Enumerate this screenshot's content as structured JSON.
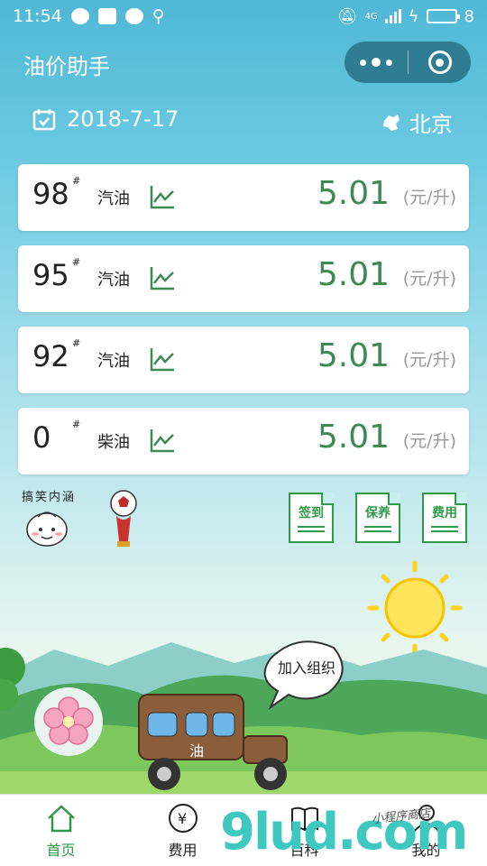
{
  "status_bar": {
    "time": "11:54",
    "network": "4G",
    "battery": "8"
  },
  "header": {
    "title": "油价助手"
  },
  "info": {
    "date": "2018-7-17",
    "city": "北京"
  },
  "prices": [
    {
      "grade": "98",
      "sharp": "#",
      "type": "汽油",
      "price": "5.01",
      "unit": "(元/升)"
    },
    {
      "grade": "95",
      "sharp": "#",
      "type": "汽油",
      "price": "5.01",
      "unit": "(元/升)"
    },
    {
      "grade": "92",
      "sharp": "#",
      "type": "汽油",
      "price": "5.01",
      "unit": "(元/升)"
    },
    {
      "grade": "0",
      "sharp": "#",
      "type": "柴油",
      "price": "5.01",
      "unit": "(元/升)"
    }
  ],
  "stickers": {
    "left_text": "搞笑内涵"
  },
  "doc_buttons": [
    {
      "label": "签到"
    },
    {
      "label": "保养"
    },
    {
      "label": "费用"
    }
  ],
  "scene": {
    "bubble": "加入组织",
    "car_text": "油"
  },
  "nav": [
    {
      "label": "首页",
      "icon": "home-icon",
      "active": true
    },
    {
      "label": "费用",
      "icon": "yen-icon",
      "active": false
    },
    {
      "label": "百科",
      "icon": "book-icon",
      "active": false
    },
    {
      "label": "我的",
      "icon": "user-icon",
      "active": false
    }
  ],
  "watermark": {
    "text": "9lud.com",
    "sub": "小程序商店"
  },
  "colors": {
    "accent": "#2f9a4a",
    "price": "#3d8a52",
    "capsule": "#2f7d92"
  }
}
